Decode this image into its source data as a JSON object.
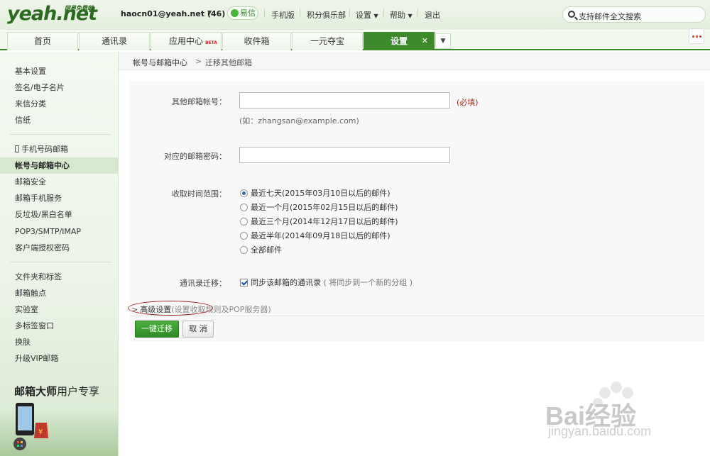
{
  "app": {
    "logo": "yeah.net",
    "logo_sub": "网易免费邮",
    "account": "haocn01@yeah.net (46)",
    "yixin": "易信",
    "links": [
      "手机版",
      "积分俱乐部",
      "设置",
      "帮助",
      "退出"
    ],
    "search_placeholder": "支持邮件全文搜索"
  },
  "tabs": [
    {
      "label": "首页",
      "active": false
    },
    {
      "label": "通讯录",
      "active": false
    },
    {
      "label": "应用中心",
      "active": false,
      "badge": "BETA"
    },
    {
      "label": "收件箱",
      "active": false
    },
    {
      "label": "一元夺宝",
      "active": false
    },
    {
      "label": "设置",
      "active": true
    }
  ],
  "sidebar": {
    "group1": [
      "基本设置",
      "签名/电子名片",
      "来信分类",
      "信纸"
    ],
    "group2": [
      "手机号码邮箱",
      "帐号与邮箱中心",
      "邮箱安全",
      "邮箱手机服务",
      "反垃圾/黑白名单",
      "POP3/SMTP/IMAP",
      "客户端授权密码"
    ],
    "group3": [
      "文件夹和标签",
      "邮箱触点",
      "实验室",
      "多标签窗口",
      "换肤",
      "升级VIP邮箱"
    ],
    "active": "帐号与邮箱中心",
    "promo_bold": "邮箱大师",
    "promo_rest": "用户专享"
  },
  "breadcrumb": {
    "parent": "帐号与邮箱中心",
    "separator": ">",
    "current": "迁移其他邮箱"
  },
  "form": {
    "account_label": "其他邮箱帐号：",
    "account_value": "",
    "required": "(必填)",
    "account_hint": "(如：zhangsan@example.com)",
    "password_label": "对应的邮箱密码：",
    "password_value": "",
    "range_label": "收取时间范围：",
    "range_options": [
      {
        "label": "最近七天(2015年03月10日以后的邮件)",
        "selected": true
      },
      {
        "label": "最近一个月(2015年02月15日以后的邮件)",
        "selected": false
      },
      {
        "label": "最近三个月(2014年12月17日以后的邮件)",
        "selected": false
      },
      {
        "label": "最近半年(2014年09月18日以后的邮件)",
        "selected": false
      },
      {
        "label": "全部邮件",
        "selected": false
      }
    ],
    "contacts_label": "通讯录迁移：",
    "contacts_checkbox": "同步该邮箱的通讯录",
    "contacts_checked": true,
    "contacts_note": "( 将同步到一个新的分组 )",
    "advanced_gt": ">",
    "advanced_label": "高级设置",
    "advanced_sub": "(设置收取规则及POP服务器)",
    "submit_label": "一键迁移",
    "cancel_label": "取 消"
  },
  "watermark": {
    "brand": "Bai经验",
    "url": "jingyan.baidu.com"
  },
  "colors": {
    "brand_green": "#3d8a2d",
    "required_red": "#a8331f",
    "oval_red": "#a01a1a"
  }
}
